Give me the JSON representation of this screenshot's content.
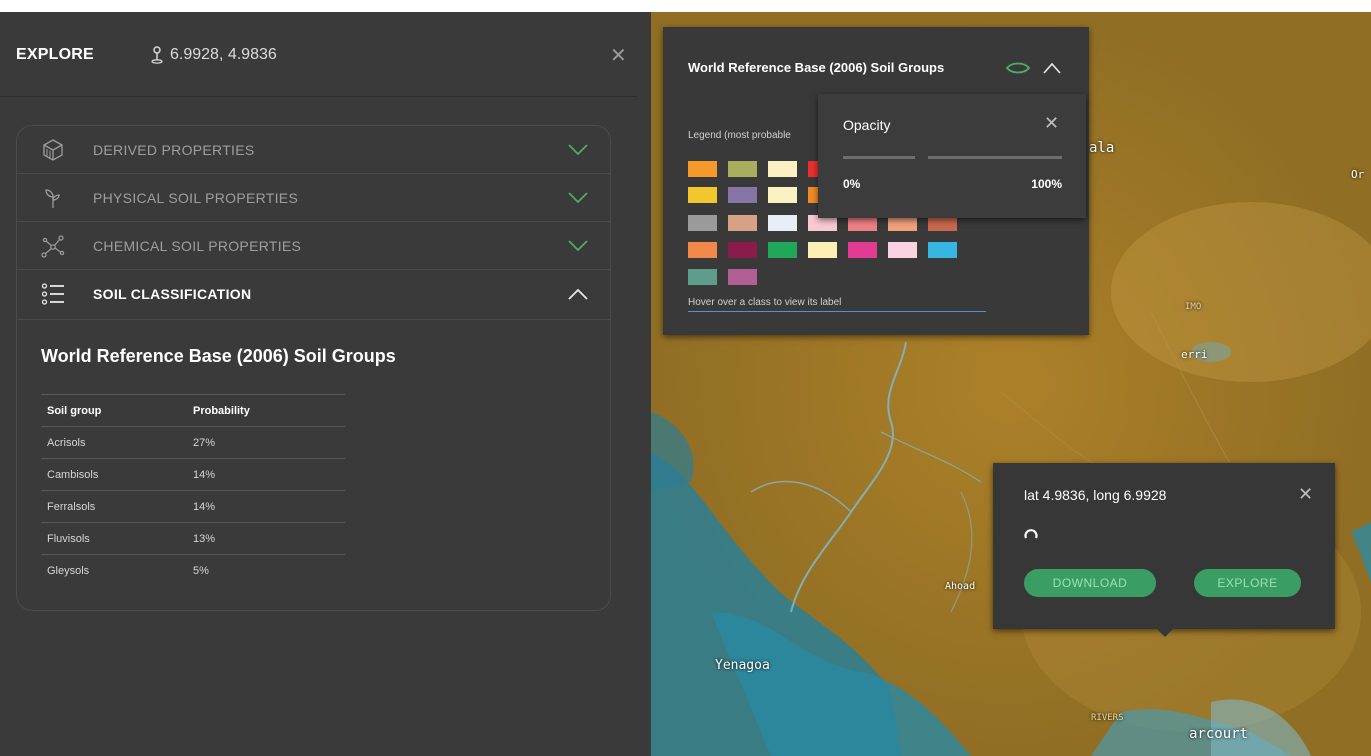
{
  "explore": {
    "title": "EXPLORE",
    "coordinates": "6.9928, 4.9836",
    "close_symbol": "✕"
  },
  "accordion": {
    "items": [
      {
        "label": "DERIVED PROPERTIES",
        "icon": "cube-icon",
        "expanded": false
      },
      {
        "label": "PHYSICAL SOIL PROPERTIES",
        "icon": "sprout-icon",
        "expanded": false
      },
      {
        "label": "CHEMICAL SOIL PROPERTIES",
        "icon": "molecule-icon",
        "expanded": false
      },
      {
        "label": "SOIL CLASSIFICATION",
        "icon": "list-icon",
        "expanded": true
      }
    ]
  },
  "classification": {
    "title": "World Reference Base (2006) Soil Groups",
    "table": {
      "headers": [
        "Soil group",
        "Probability"
      ],
      "rows": [
        [
          "Acrisols",
          "27%"
        ],
        [
          "Cambisols",
          "14%"
        ],
        [
          "Ferralsols",
          "14%"
        ],
        [
          "Fluvisols",
          "13%"
        ],
        [
          "Gleysols",
          "5%"
        ]
      ]
    }
  },
  "legend": {
    "title": "World Reference Base (2006) Soil Groups",
    "subtitle": "Legend (most probable",
    "hint": "Hover over a class to view its label",
    "swatch_colors": [
      [
        "#f39a2b",
        "#a8ad5f",
        "#fbf0c3",
        "#e8312c"
      ],
      [
        "#f2c62d",
        "#8676a8",
        "#fbf2c1",
        "#f08a24"
      ],
      [
        "#9a9a9a",
        "#d7a186",
        "#e8eef6",
        "#f8c9d3",
        "#ee7f87",
        "#f0a07d",
        "#c7694c"
      ],
      [
        "#f0894a",
        "#8a1b4b",
        "#1fa858",
        "#fcf0b5",
        "#e23b93",
        "#f9d3e1",
        "#36b6e2"
      ],
      [
        "#5c9e8b",
        "#b05e93"
      ]
    ]
  },
  "opacity": {
    "title": "Opacity",
    "min_label": "0%",
    "max_label": "100%",
    "close_symbol": "✕"
  },
  "point_popup": {
    "title": "lat 4.9836, long 6.9928",
    "download_label": "DOWNLOAD",
    "explore_label": "EXPLORE",
    "close_symbol": "✕"
  },
  "map_labels": {
    "ala": "ala",
    "or": "Or",
    "imo": "IMO",
    "erri": "erri",
    "ahoad": "Ahoad",
    "yenagoa": "Yenagoa",
    "rivers": "RIVERS",
    "arcourt": "arcourt"
  },
  "colors": {
    "panel": "#3a3a3a",
    "accent_green": "#3a9e64",
    "chevron_green": "#4caf63"
  }
}
